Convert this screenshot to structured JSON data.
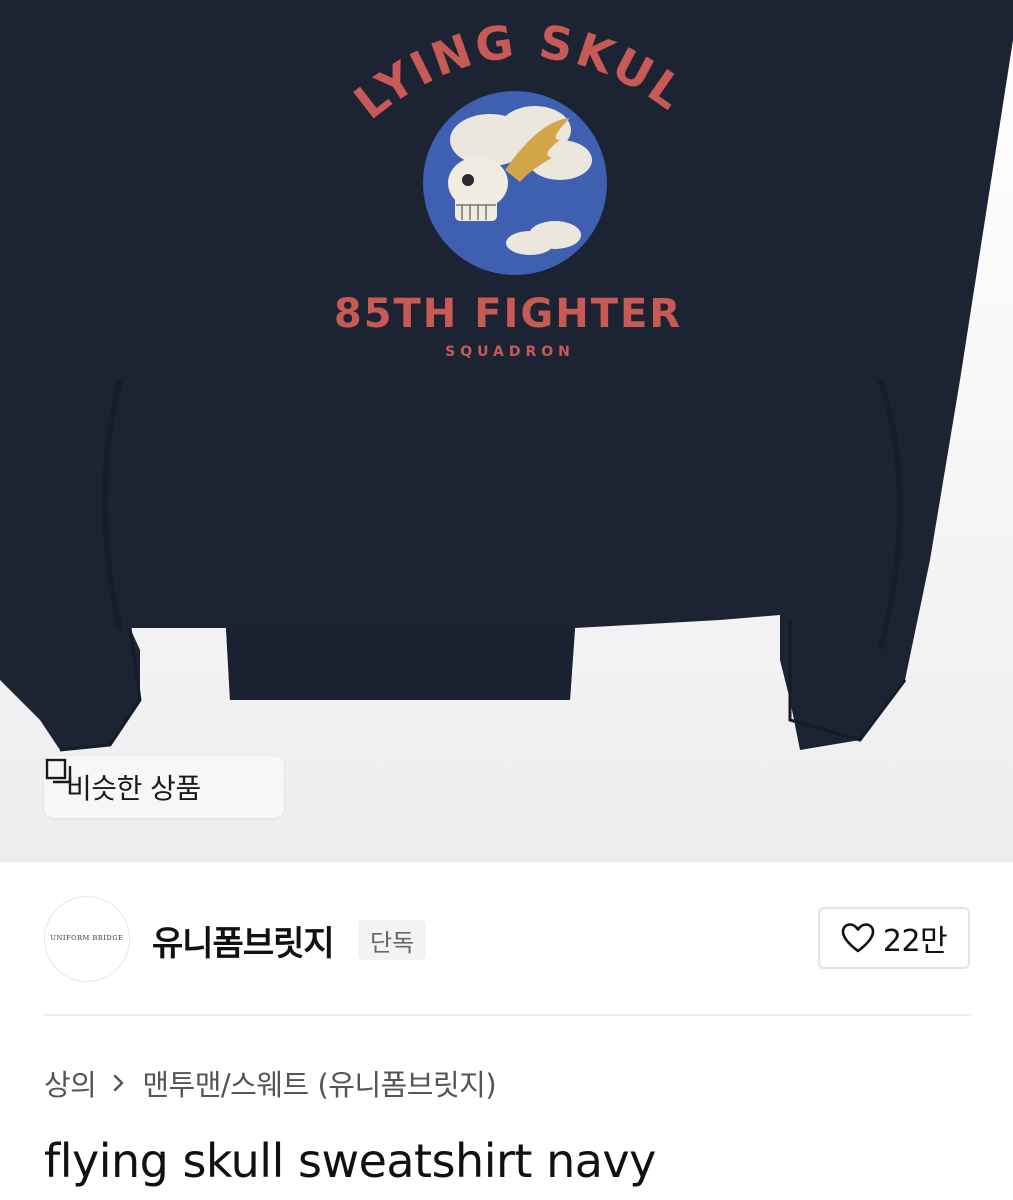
{
  "product_image": {
    "alt": "flying skull sweatshirt navy",
    "graphic_text": {
      "arc_text": "FLYING SKULL",
      "main_line": "85TH FIGHTER",
      "sub_line": "SQUADRON"
    },
    "colors": {
      "garment": "#1c2434",
      "print_red": "#c85a55",
      "patch_blue": "#3f5fb0"
    }
  },
  "similar_button": {
    "label": "비슷한 상품",
    "icon": "similar-items-icon"
  },
  "brand": {
    "logo_text": "UNIFORM BRIDGE",
    "name": "유니폼브릿지",
    "badge": "단독"
  },
  "like": {
    "icon": "heart-icon",
    "count": "22만"
  },
  "breadcrumb": {
    "category": "상의",
    "separator_icon": "chevron-right-icon",
    "subcategory": "맨투맨/스웨트 (유니폼브릿지)"
  },
  "product": {
    "title": "flying skull sweatshirt navy"
  }
}
